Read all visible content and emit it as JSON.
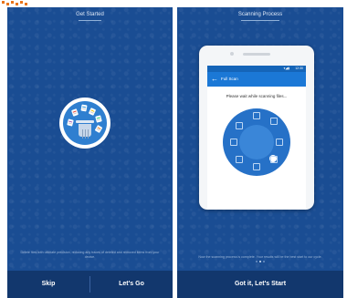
{
  "left_panel": {
    "title": "Get Started",
    "description": "Delete files with ultimate precision, reducing any traces of deleted and removed items from your device.",
    "skip_label": "Skip",
    "go_label": "Let's Go"
  },
  "right_panel": {
    "title": "Scanning Process",
    "phone": {
      "status_time": "12:30",
      "status_icons": "▾◢▮",
      "app_title": "Full Scan",
      "wait_text": "Please wait while scanning files..."
    },
    "description": "Now the scanning process is complete. Your results will be the best start to our cycle.",
    "start_label": "Got it, Let's Start"
  },
  "icons": {
    "back": "←",
    "doc_colors": [
      "#e74c3c",
      "#3498db",
      "#f1c40f",
      "#2ecc71",
      "#9b59b6",
      "#e67e22"
    ]
  },
  "colors": {
    "panel_bg": "#1a4d93",
    "footer_bg": "#12376d",
    "accent": "#1b78d6",
    "corner_mark": "#e8741c"
  }
}
